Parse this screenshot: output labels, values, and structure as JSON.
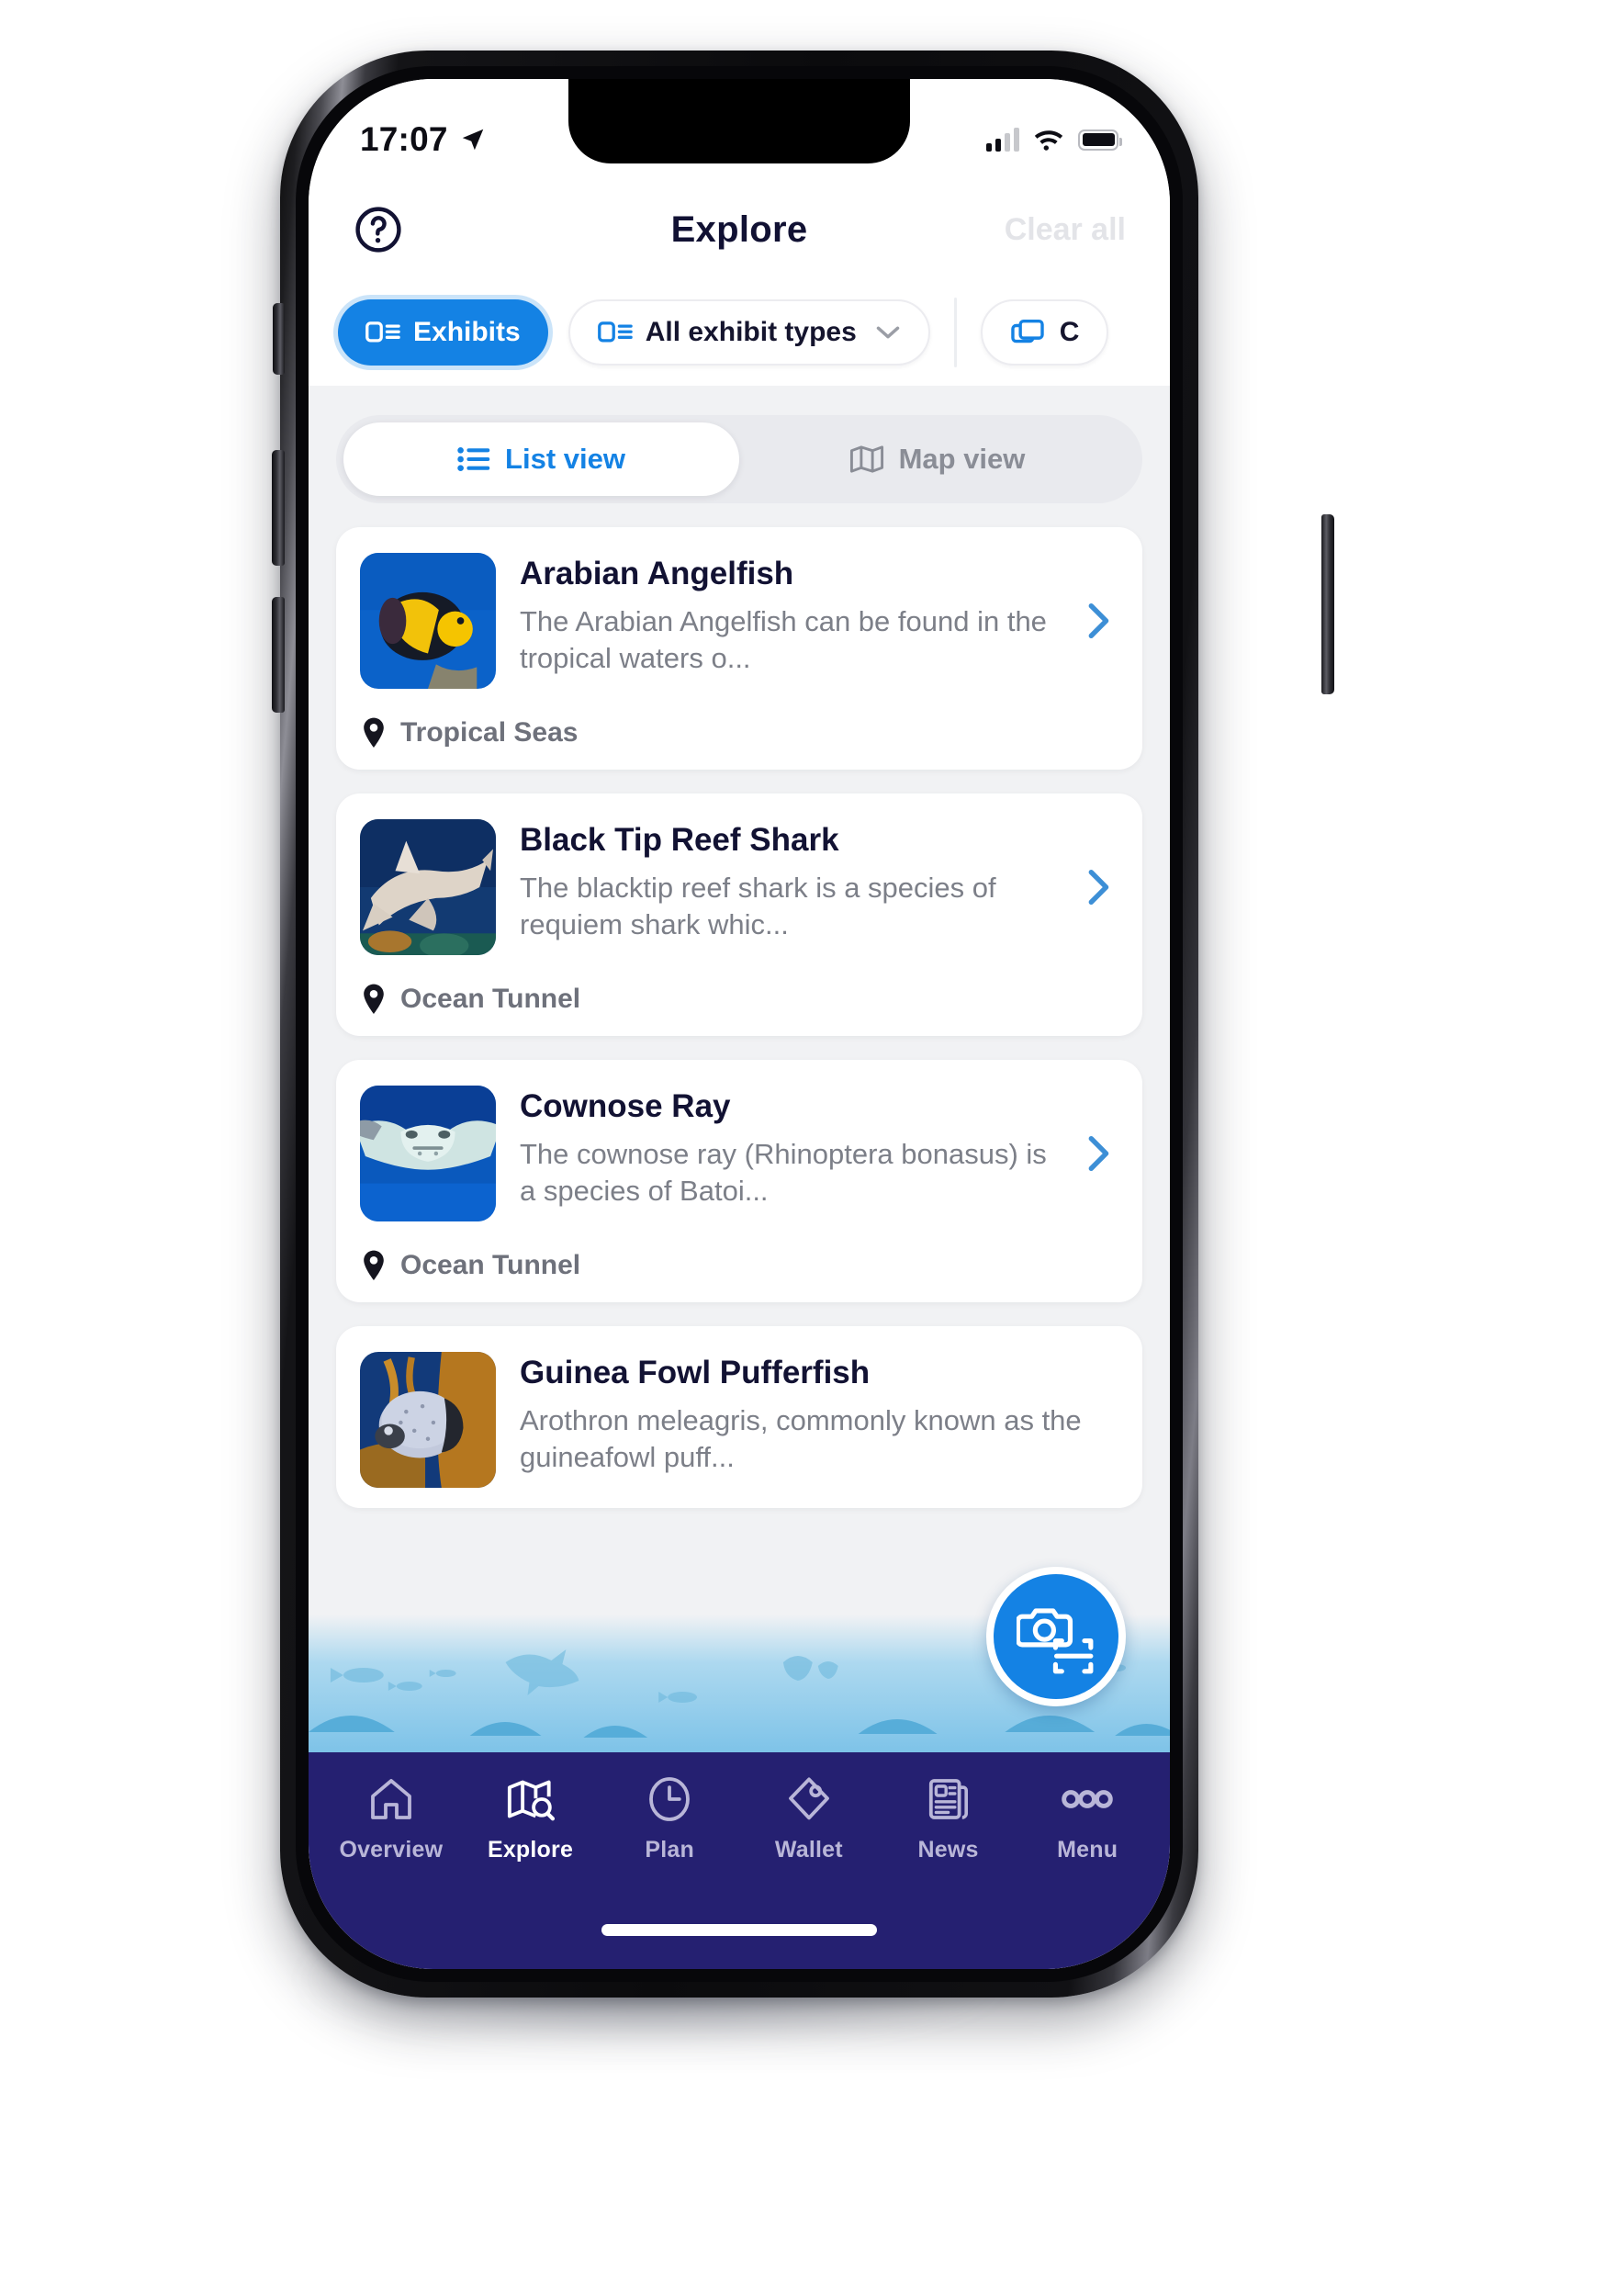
{
  "status_bar": {
    "time": "17:07",
    "location_icon": "location-arrow-icon",
    "signal_icon": "cellular-signal-icon",
    "wifi_icon": "wifi-icon",
    "battery_icon": "battery-icon"
  },
  "header": {
    "help_icon": "help-circle-icon",
    "title": "Explore",
    "clear_all_label": "Clear all"
  },
  "filters": {
    "chips": [
      {
        "label": "Exhibits",
        "icon": "exhibit-list-icon",
        "active": true,
        "has_chevron": false
      },
      {
        "label": "All exhibit types",
        "icon": "exhibit-list-icon",
        "active": false,
        "has_chevron": true
      },
      {
        "label": "C",
        "icon": "layers-cards-icon",
        "active": false,
        "has_chevron": false
      }
    ],
    "accent_color": "#1482e4"
  },
  "view_toggle": {
    "list_label": "List view",
    "list_icon": "list-bullet-icon",
    "map_label": "Map view",
    "map_icon": "map-folded-icon",
    "selected": "list"
  },
  "list": {
    "items": [
      {
        "title": "Arabian Angelfish",
        "description": "The Arabian Angelfish can be found in the tropical waters o...",
        "location": "Tropical Seas",
        "thumb": "arabian-angelfish-photo"
      },
      {
        "title": "Black Tip Reef Shark",
        "description": "The blacktip reef shark is a species of requiem shark whic...",
        "location": "Ocean Tunnel",
        "thumb": "black-tip-reef-shark-photo"
      },
      {
        "title": "Cownose Ray",
        "description": "The cownose ray (Rhinoptera bonasus) is a species of Batoi...",
        "location": "Ocean Tunnel",
        "thumb": "cownose-ray-photo"
      },
      {
        "title": "Guinea Fowl Pufferfish",
        "description": "Arothron meleagris, commonly known as the guineafowl puff...",
        "location": "",
        "thumb": "guinea-fowl-pufferfish-photo"
      }
    ],
    "location_icon": "map-pin-icon",
    "arrow_icon": "chevron-right-icon"
  },
  "fab": {
    "icon": "camera-scan-icon",
    "color": "#1482e4"
  },
  "bottom_nav": {
    "background_color": "#252071",
    "items": [
      {
        "label": "Overview",
        "icon": "home-icon",
        "active": false
      },
      {
        "label": "Explore",
        "icon": "map-search-icon",
        "active": true
      },
      {
        "label": "Plan",
        "icon": "clock-icon",
        "active": false
      },
      {
        "label": "Wallet",
        "icon": "tag-icon",
        "active": false
      },
      {
        "label": "News",
        "icon": "newspaper-icon",
        "active": false
      },
      {
        "label": "Menu",
        "icon": "three-dots-icon",
        "active": false
      }
    ]
  }
}
